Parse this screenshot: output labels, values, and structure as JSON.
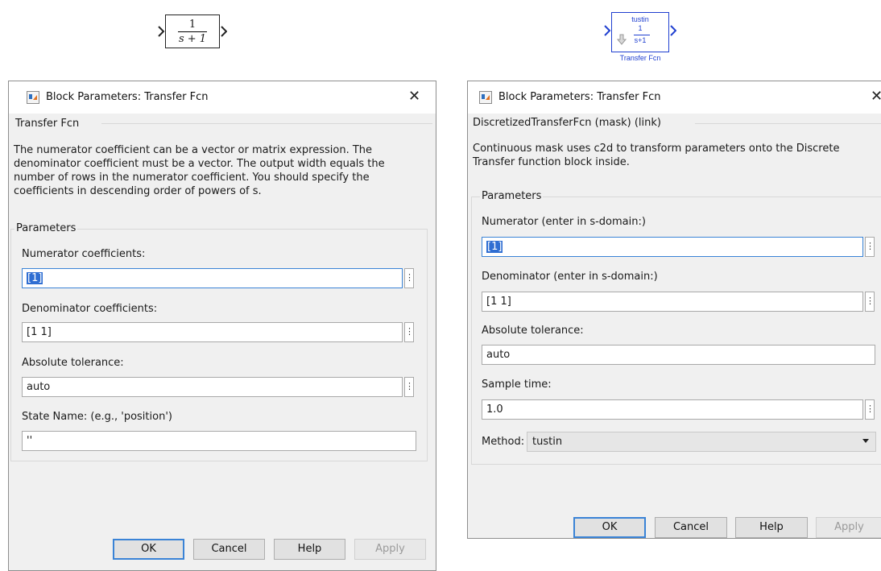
{
  "canvas": {
    "tf_block": {
      "numerator": "1",
      "denominator": "s + 1"
    },
    "mask_block": {
      "method": "tustin",
      "numerator": "1",
      "denominator": "s+1",
      "label": "Transfer Fcn"
    }
  },
  "dialog_left": {
    "title": "Block Parameters: Transfer Fcn",
    "close": "✕",
    "block_group": "Transfer Fcn",
    "description": "The numerator coefficient can be a vector or matrix expression. The denominator coefficient must be a vector. The output width equals the number of rows in the numerator coefficient. You should specify the coefficients in descending order of powers of s.",
    "params_group": "Parameters",
    "numerator_label": "Numerator coefficients:",
    "numerator_value": "[1]",
    "denominator_label": "Denominator coefficients:",
    "denominator_value": "[1 1]",
    "abstol_label": "Absolute tolerance:",
    "abstol_value": "auto",
    "statename_label": "State Name: (e.g., 'position')",
    "statename_value": "''",
    "buttons": {
      "ok": "OK",
      "cancel": "Cancel",
      "help": "Help",
      "apply": "Apply"
    }
  },
  "dialog_right": {
    "title": "Block Parameters: Transfer Fcn",
    "close": "✕",
    "block_group": "DiscretizedTransferFcn (mask) (link)",
    "description": "Continuous mask uses c2d to transform parameters onto the Discrete Transfer function block inside.",
    "params_group": "Parameters",
    "numerator_label": "Numerator (enter in s-domain:)",
    "numerator_value": "[1]",
    "denominator_label": "Denominator (enter in s-domain:)",
    "denominator_value": "[1 1]",
    "abstol_label": "Absolute tolerance:",
    "abstol_value": "auto",
    "sampletime_label": "Sample time:",
    "sampletime_value": "1.0",
    "method_label": "Method:",
    "method_value": "tustin",
    "buttons": {
      "ok": "OK",
      "cancel": "Cancel",
      "help": "Help",
      "apply": "Apply"
    }
  },
  "icons": {
    "kebab": "⋮",
    "port_color_left": "#222222",
    "port_color_right": "#1f3fd0",
    "focus_color": "#3a83d6",
    "selection_color": "#2f6ed2"
  }
}
